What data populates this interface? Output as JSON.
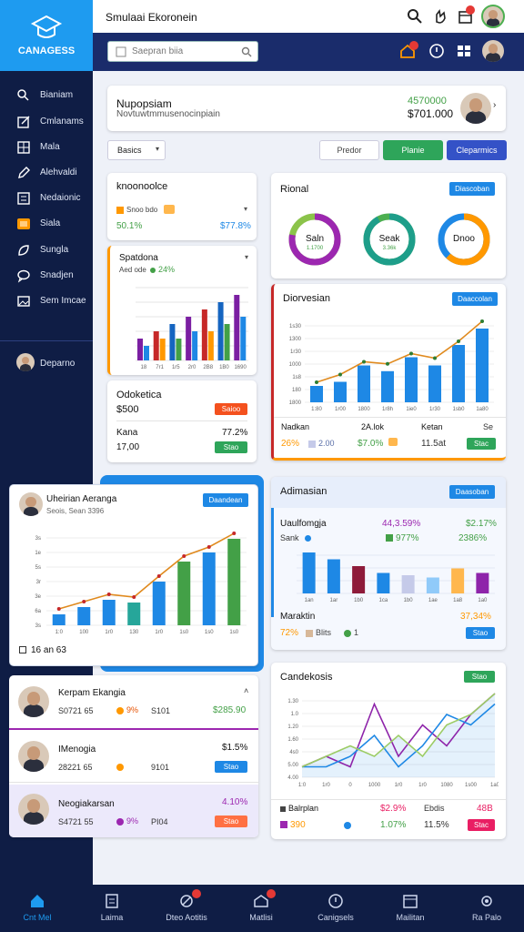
{
  "brand": {
    "name": "CANAGESS"
  },
  "header": {
    "title": "Smulaai Ekoronein"
  },
  "search": {
    "placeholder": "Saepran biia"
  },
  "sidebar": {
    "items": [
      {
        "label": "Bianiam",
        "icon": "search-icon"
      },
      {
        "label": "Cmlanams",
        "icon": "edit-icon"
      },
      {
        "label": "Mala",
        "icon": "grid-icon"
      },
      {
        "label": "Alehvaldi",
        "icon": "pen-icon"
      },
      {
        "label": "Nedaionic",
        "icon": "list-icon"
      },
      {
        "label": "Siala",
        "icon": "folder-icon"
      },
      {
        "label": "Sungla",
        "icon": "leaf-icon"
      },
      {
        "label": "Snadjen",
        "icon": "chat-icon"
      },
      {
        "label": "Sem Imcae",
        "icon": "image-icon"
      }
    ],
    "user": "Deparno"
  },
  "profile_card": {
    "title": "Nupopsiam",
    "subtitle": "Novtuwtmmusenocinpiain",
    "amount1": "4570000",
    "amount2": "$701.000"
  },
  "filter": {
    "select": "Basics",
    "tabs": [
      "Predor",
      "Planie",
      "Cleparmics"
    ]
  },
  "card_knoo": {
    "title": "knoonoolce",
    "legend": "Snoo bdo",
    "value1": "50.1%",
    "value2": "$77.8%"
  },
  "card_rional": {
    "title": "Rional",
    "button": "Diascoban",
    "donuts": [
      {
        "label": "Saln",
        "sub": "1.1700",
        "color": "#9c27b0",
        "track": "#8bc34a",
        "pct": 0.78
      },
      {
        "label": "Seak",
        "sub": "3.36k",
        "color": "#1e9e8a",
        "track": "#4caf50",
        "pct": 0.92
      },
      {
        "label": "Dnoo",
        "sub": "",
        "color": "#ff9800",
        "track": "#1e88e5",
        "pct": 0.62
      }
    ]
  },
  "card_spatdona": {
    "title": "Spatdona",
    "sub": "Aed ode",
    "change": "24%",
    "ticks": [
      "18",
      "7r1",
      "1r5",
      "2r0",
      "2B8",
      "1B0",
      "1690"
    ]
  },
  "card_diorvesian": {
    "title": "Diorvesian",
    "button": "Daaccolan",
    "yticks": [
      "1800",
      "180",
      "1s8",
      "1000",
      "1r30",
      "1300",
      "1s30"
    ],
    "xticks": [
      "1:80",
      "1r00",
      "1800",
      "1r8h",
      "1ie0",
      "1r30",
      "1sb0",
      "1a80"
    ],
    "stats": [
      {
        "label": "Nadkan",
        "value": "26%",
        "color": "#ff9800"
      },
      {
        "label": "2A.lok",
        "value": "2.00",
        "color": "#5a6fa8"
      },
      {
        "label": "",
        "value": "$7.0%",
        "color": "#43a047"
      },
      {
        "label": "Ketan",
        "value": "11.5at",
        "color": "#333"
      },
      {
        "label": "Se",
        "value": "Stac",
        "color": "#43a047"
      }
    ]
  },
  "card_odoketica": {
    "title": "Odoketica",
    "value": "$500",
    "pill": "Saioo",
    "kana_label": "Kana",
    "kana_value": "17,00",
    "kana_pct": "77.2%",
    "pill2": "Stao"
  },
  "card_uheirian": {
    "title": "Uheirian Aeranga",
    "subtitle": "Seois, Sean 3396",
    "button": "Daandean",
    "footer": "16 an 63",
    "yticks": [
      "3s",
      "6a",
      "3e",
      "3r",
      "5s",
      "1e",
      "3s"
    ],
    "xticks": [
      "1:0",
      "100",
      "1r0",
      "130",
      "1r0",
      "1s0",
      "1s0",
      "1s0"
    ]
  },
  "card_adimasian": {
    "title": "Adimasian",
    "button": "Daasoban",
    "row1": {
      "label": "Uaulfomgja",
      "pct1": "44,3.59%",
      "pct2": "$2.17%"
    },
    "row2": {
      "label": "Sank",
      "pct1": "977%",
      "pct2": "2386%"
    },
    "xticks": [
      "1an",
      "1ar",
      "1b0",
      "1ca",
      "1b0",
      "1ae",
      "1a8",
      "1a0"
    ],
    "row3": {
      "label": "Maraktin",
      "value": "37,34%"
    },
    "row4": {
      "value": "72%",
      "legend": "Blits",
      "count": "1",
      "pill": "Stao"
    }
  },
  "list_rows": [
    {
      "name": "Kerpam Ekangia",
      "num": "S0721 65",
      "pct": "9%",
      "code": "S101",
      "amount": "$285.90",
      "dot": "#ff9800",
      "amount_color": "#43a047"
    },
    {
      "name": "IMenogia",
      "num": "28221 65",
      "pct": "",
      "code": "9101",
      "amount": "$1.5%",
      "dot": "#ff9800",
      "amount_color": "#111",
      "pill": "Stao"
    },
    {
      "name": "Neogiakarsan",
      "num": "S4721 55",
      "pct": "9%",
      "code": "PI04",
      "amount": "4.10%",
      "dot": "#9c27b0",
      "amount_color": "#9c27b0",
      "pill": "Stao"
    }
  ],
  "card_candekosis": {
    "title": "Candekosis",
    "button": "Stao",
    "yticks": [
      "4.00",
      "5.00",
      "4s0",
      "1.60",
      "1.20",
      "1.0",
      "1.30"
    ],
    "xticks": [
      "1:0",
      "1r0",
      "0",
      "1000",
      "1r0",
      "1r0",
      "1080",
      "1s00",
      "1a0"
    ],
    "stats": [
      {
        "label": "Balrplan",
        "value": "390",
        "color": "#9c27b0"
      },
      {
        "label": "$2.9%",
        "value": "1.07%",
        "color": "#e91e63"
      },
      {
        "label": "Ebdis",
        "value": "11.5%",
        "color": "#333"
      },
      {
        "label": "48B",
        "value": "Stac",
        "color": "#e91e63"
      }
    ]
  },
  "bottom_nav": [
    "Cnt Mel",
    "Laima",
    "Dteo Aotitis",
    "Matlisi",
    "Canigsels",
    "Mailitan",
    "Ra Palo"
  ],
  "chart_data": [
    {
      "type": "bar",
      "title": "Spatdona",
      "categories": [
        "18",
        "7r1",
        "1r5",
        "2r0",
        "2B8",
        "1B0",
        "1690"
      ],
      "series": [
        {
          "values": [
            3,
            4,
            5,
            6,
            7,
            8,
            9
          ]
        },
        {
          "values": [
            2,
            3,
            3,
            4,
            4,
            5,
            6
          ]
        }
      ]
    },
    {
      "type": "bar",
      "title": "Diorvesian",
      "categories": [
        "1:80",
        "1r00",
        "1800",
        "1r8h",
        "1ie0",
        "1r30",
        "1sb0",
        "1a80"
      ],
      "series": [
        {
          "values": [
            20,
            25,
            45,
            38,
            55,
            45,
            70,
            90
          ]
        }
      ]
    },
    {
      "type": "bar",
      "title": "Uheirian Aeranga",
      "categories": [
        "1:0",
        "100",
        "1r0",
        "130",
        "1r0",
        "1s0",
        "1s0",
        "1s0"
      ],
      "series": [
        {
          "values": [
            12,
            20,
            28,
            25,
            48,
            70,
            80,
            95
          ]
        }
      ]
    },
    {
      "type": "bar",
      "title": "Adimasian",
      "categories": [
        "1an",
        "1ar",
        "1b0",
        "1ca",
        "1b0",
        "1ae",
        "1a8",
        "1a0"
      ],
      "series": [
        {
          "values": [
            90,
            75,
            60,
            45,
            40,
            35,
            55,
            45
          ]
        }
      ]
    },
    {
      "type": "line",
      "title": "Candekosis",
      "x": [
        "1:0",
        "1r0",
        "0",
        "1000",
        "1r0",
        "1r0",
        "1080",
        "1s00",
        "1a0"
      ],
      "series": [
        {
          "values": [
            1,
            2,
            1,
            7,
            2,
            5,
            3,
            6,
            8
          ]
        },
        {
          "values": [
            1,
            1,
            2,
            4,
            1,
            3,
            6,
            5,
            7
          ]
        },
        {
          "values": [
            1,
            2,
            3,
            2,
            4,
            2,
            5,
            6,
            8
          ]
        }
      ]
    }
  ]
}
